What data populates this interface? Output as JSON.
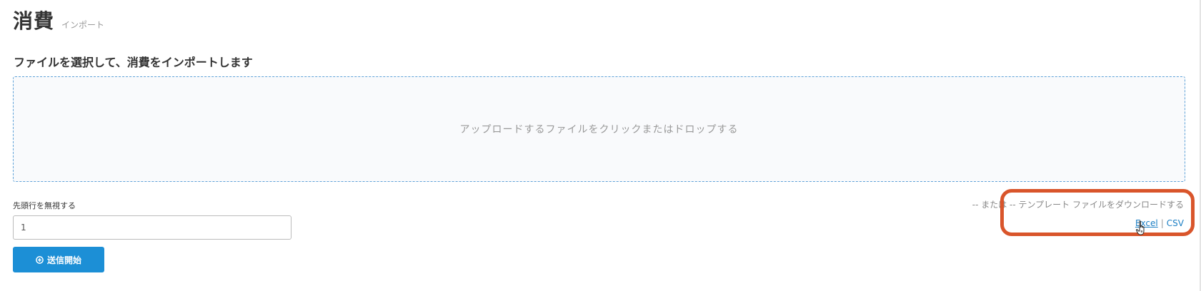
{
  "page": {
    "title": "消費",
    "subtitle": "インポート"
  },
  "upload": {
    "heading": "ファイルを選択して、消費をインポートします",
    "dropzone_text": "アップロードするファイルをクリックまたはドロップする"
  },
  "skip_rows": {
    "label": "先頭行を無視する",
    "value": "1"
  },
  "start_button": {
    "label": "送信開始",
    "icon": "plus-circle-icon"
  },
  "template": {
    "text": "-- または -- テンプレート ファイルをダウンロードする",
    "excel_label": "Excel",
    "separator": "|",
    "csv_label": "CSV"
  },
  "annotation": {
    "highlight_color": "#d9552b"
  },
  "colors": {
    "accent": "#1c8fd6",
    "link": "#1c7fc4",
    "dropzone_border": "#5fa2d8"
  }
}
